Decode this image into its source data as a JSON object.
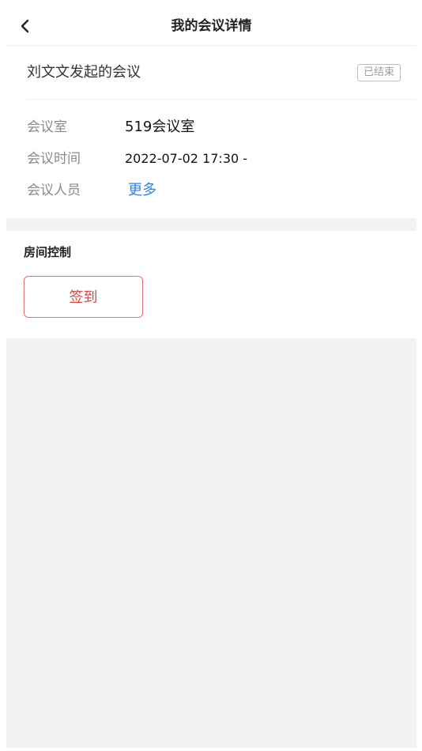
{
  "header": {
    "title": "我的会议详情",
    "back_icon": "chevron-left-icon"
  },
  "meeting": {
    "organizer_text": "刘文文发起的会议",
    "status": "已结束",
    "details": {
      "room_label": "会议室",
      "room_value": "519会议室",
      "time_label": "会议时间",
      "time_value": "2022-07-02 17:30 -",
      "members_label": "会议人员",
      "members_link": "更多"
    }
  },
  "room_control": {
    "title": "房间控制",
    "checkin_button": "签到"
  },
  "colors": {
    "link": "#2f7ff2",
    "checkin": "#d64545",
    "background": "#f2f2f2"
  }
}
